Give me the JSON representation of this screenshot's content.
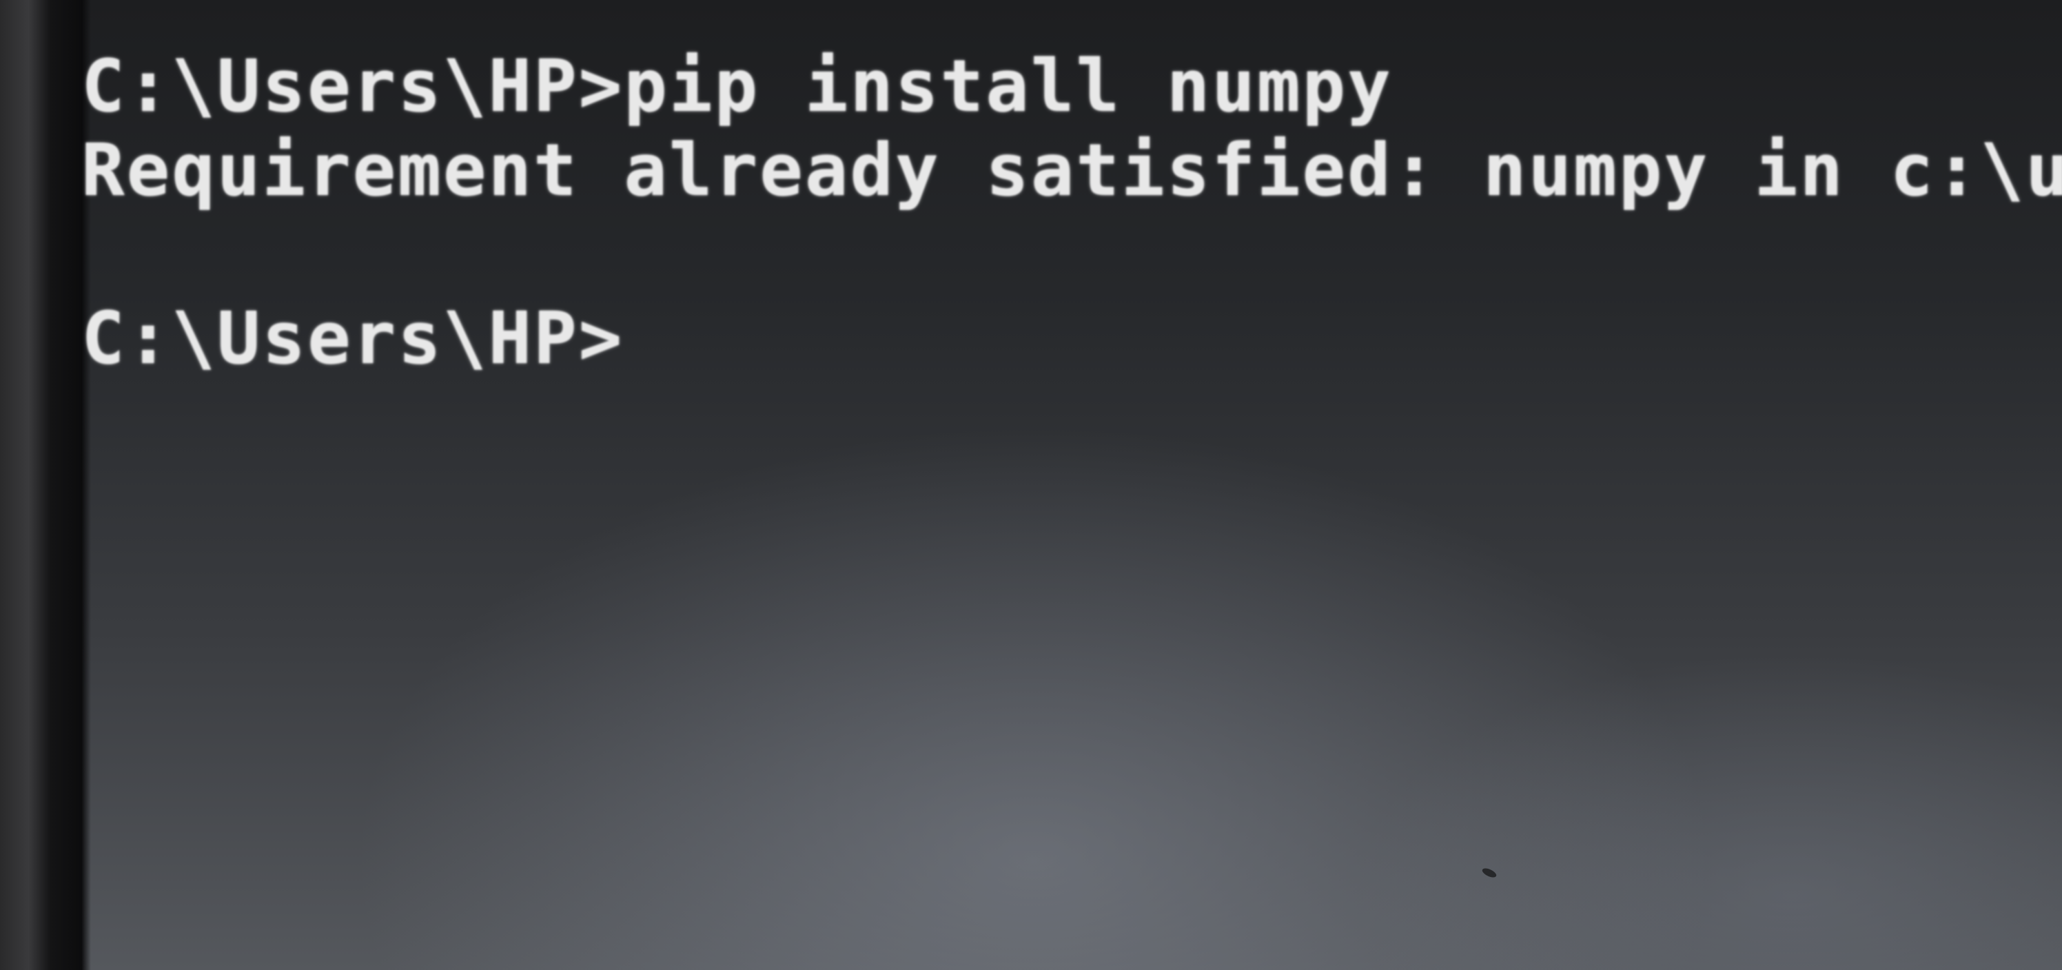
{
  "terminal": {
    "lines": [
      {
        "prompt": "C:\\Users\\HP>",
        "command": "pip install numpy"
      },
      {
        "output": "Requirement already satisfied: numpy in c:\\use"
      },
      {
        "prompt": "C:\\Users\\HP>",
        "command": ""
      }
    ],
    "colors": {
      "text": "#e8e8e8",
      "background": "#2a2c2f"
    }
  }
}
